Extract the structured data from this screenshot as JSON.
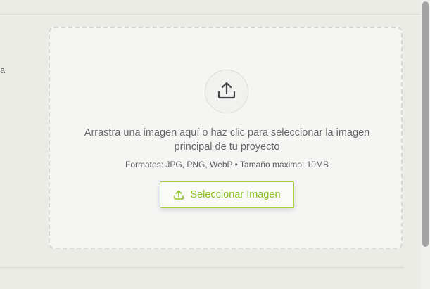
{
  "side": {
    "truncated_text": "a"
  },
  "dropzone": {
    "upload_icon": "upload-icon",
    "instructions": "Arrastra una imagen aquí o haz clic para seleccionar la imagen principal de tu proyecto",
    "formats": "Formatos: JPG, PNG, WebP • Tamaño máximo: 10MB",
    "button_label": "Seleccionar Imagen",
    "button_icon": "upload-icon"
  },
  "colors": {
    "accent": "#8cc320",
    "accent_border": "#a7cf3f",
    "dropzone_bg": "#f5f5f4",
    "page_bg": "#ecece7"
  }
}
